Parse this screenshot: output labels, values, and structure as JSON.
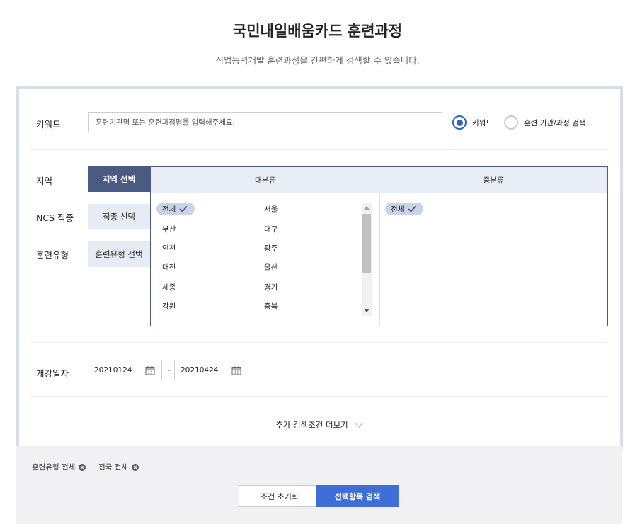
{
  "header": {
    "title": "국민내일배움카드 훈련과정",
    "subtitle": "직업능력개발 훈련과정을 간편하게 검색할 수 있습니다."
  },
  "keyword": {
    "label": "키워드",
    "placeholder": "훈련기관명 또는 훈련과정명을 입력해주세요.",
    "options": [
      {
        "label": "키워드",
        "selected": true
      },
      {
        "label": "훈련 기관/과정 검색",
        "selected": false
      }
    ]
  },
  "filters": {
    "labels": [
      "지역",
      "NCS 직종",
      "훈련유형"
    ],
    "buttons": [
      {
        "label": "지역 선택",
        "active": true
      },
      {
        "label": "직종 선택",
        "active": false
      },
      {
        "label": "훈련유형 선택",
        "active": false
      }
    ]
  },
  "region_panel": {
    "major_header": "대분류",
    "minor_header": "중분류",
    "major_col1": [
      "전체",
      "부산",
      "인천",
      "대전",
      "세종",
      "강원"
    ],
    "major_col2": [
      "서울",
      "대구",
      "광주",
      "울산",
      "경기",
      "충북"
    ],
    "selected_major": "전체",
    "selected_minor": "전체"
  },
  "dates": {
    "label": "개강일자",
    "start": "20210124",
    "separator": "~",
    "end": "20210424"
  },
  "more_label": "추가 검색조건 더보기",
  "tags": [
    "훈련유형 전체",
    "전국 전체"
  ],
  "actions": {
    "reset": "조건 초기화",
    "search": "선택항목 검색"
  },
  "colors": {
    "accent": "#2f62c8",
    "nav_active": "#4b5a82",
    "search_button": "#3f6fd6",
    "panel_border": "#d8dde7"
  }
}
